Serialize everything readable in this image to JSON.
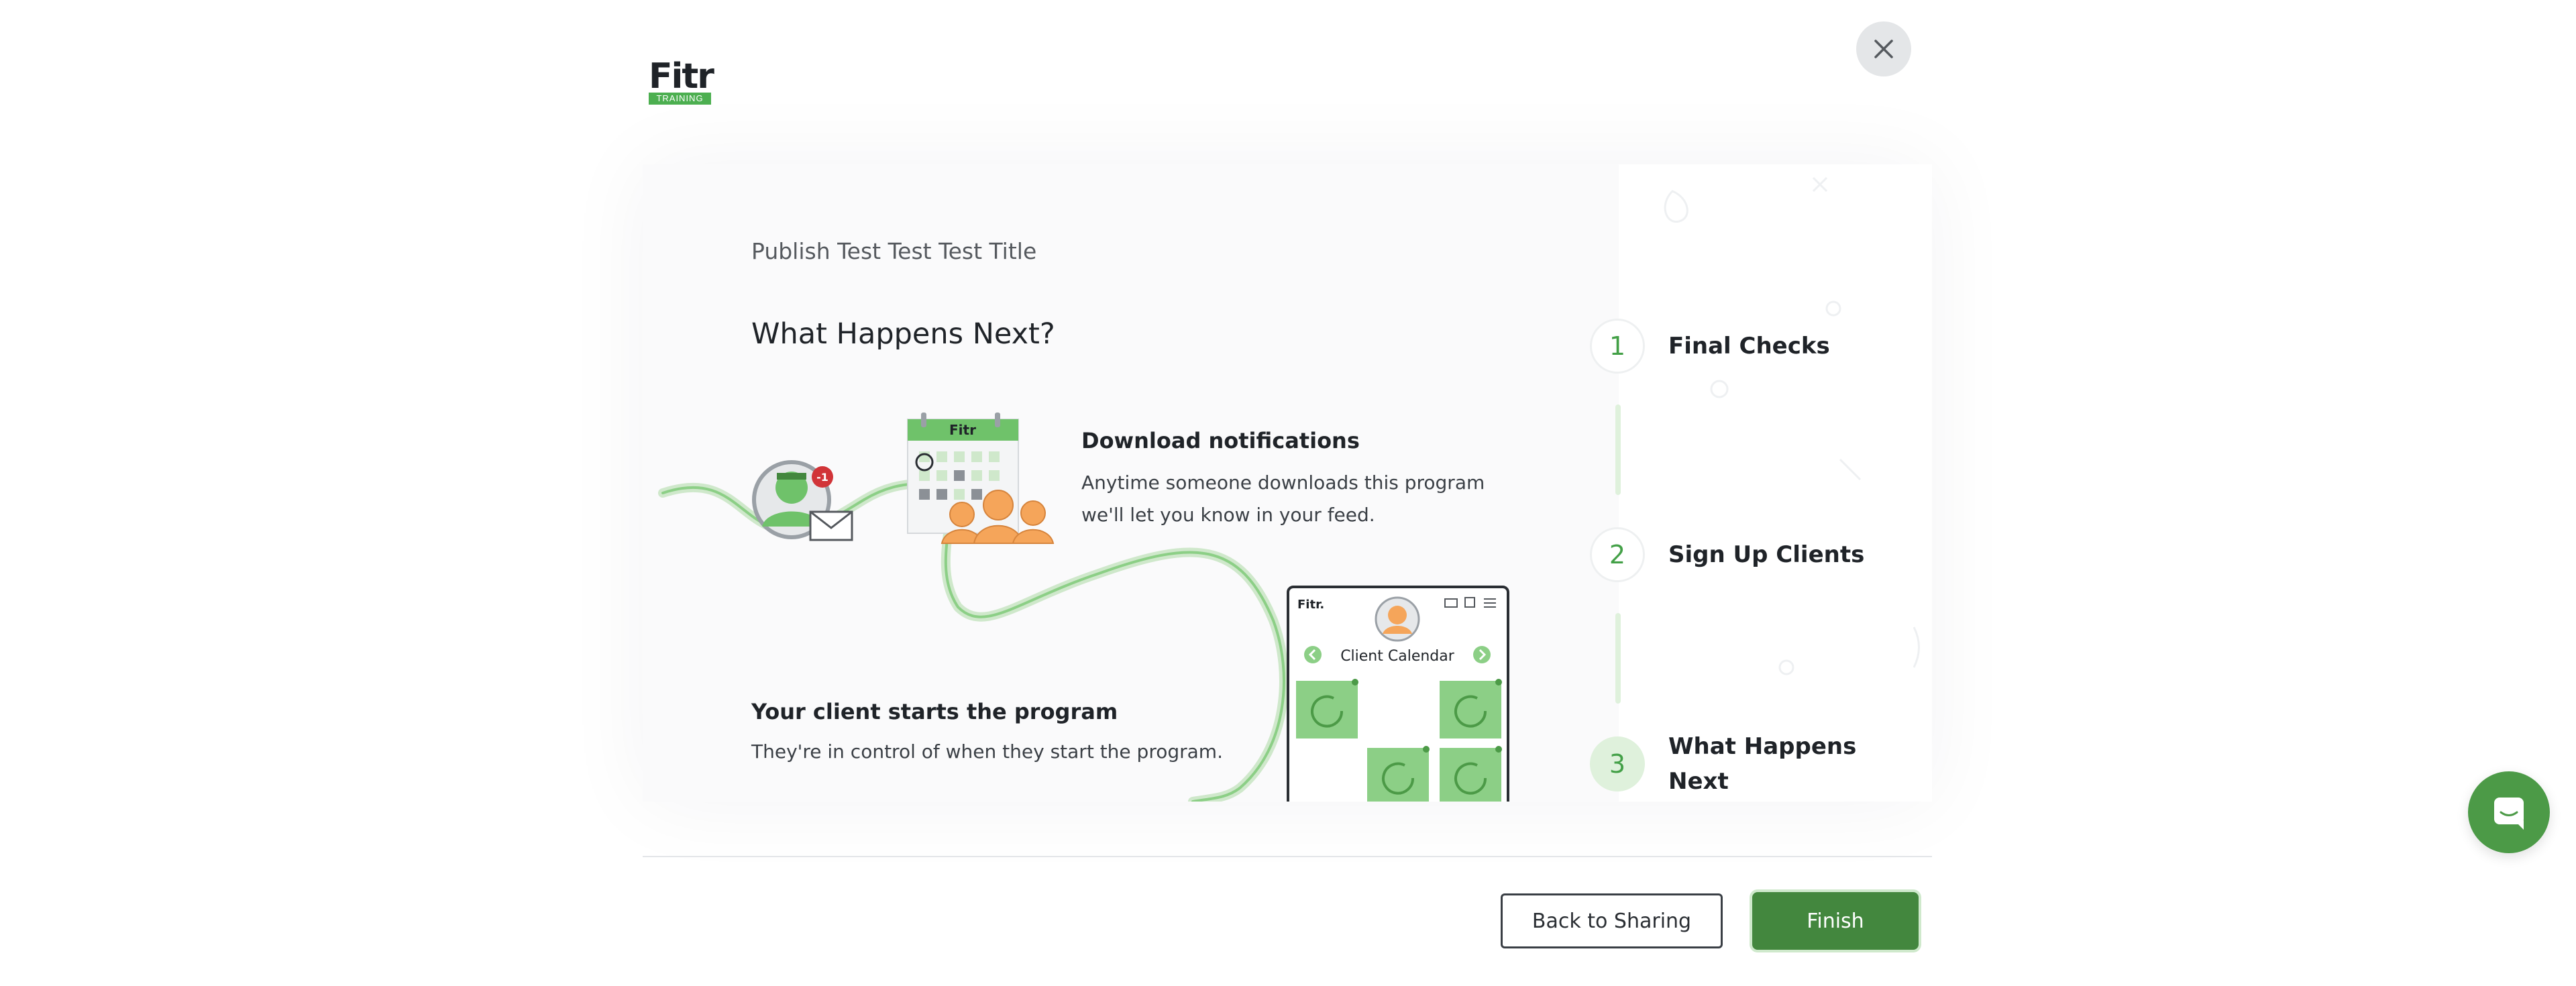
{
  "brand": {
    "logo_text": "Fitr",
    "logo_badge": "TRAINING"
  },
  "colors": {
    "accent": "#43873e",
    "accent_light": "#dff1dc",
    "brand_green": "#4caf50"
  },
  "icons": {
    "close": "close-icon",
    "chat": "chat-icon"
  },
  "main": {
    "program_title": "Publish Test Test Test Title",
    "heading": "What Happens Next?",
    "steps": [
      {
        "title": "Download notifications",
        "body_line1": "Anytime someone downloads this program",
        "body_line2": "we'll let you know in your feed."
      },
      {
        "title": "Your client starts the program",
        "body_line1": "They're in control of when they start the program."
      }
    ],
    "illustration": {
      "notification_badge": "-1",
      "calendar_brand": "Fitr",
      "phone_brand": "Fitr.",
      "phone_title": "Client Calendar"
    }
  },
  "stepper": {
    "items": [
      {
        "number": "1",
        "label": "Final Checks",
        "active": false
      },
      {
        "number": "2",
        "label": "Sign Up Clients",
        "active": false
      },
      {
        "number": "3",
        "label_line1": "What Happens",
        "label_line2": "Next",
        "active": true
      }
    ]
  },
  "footer": {
    "back_label": "Back to Sharing",
    "finish_label": "Finish"
  }
}
